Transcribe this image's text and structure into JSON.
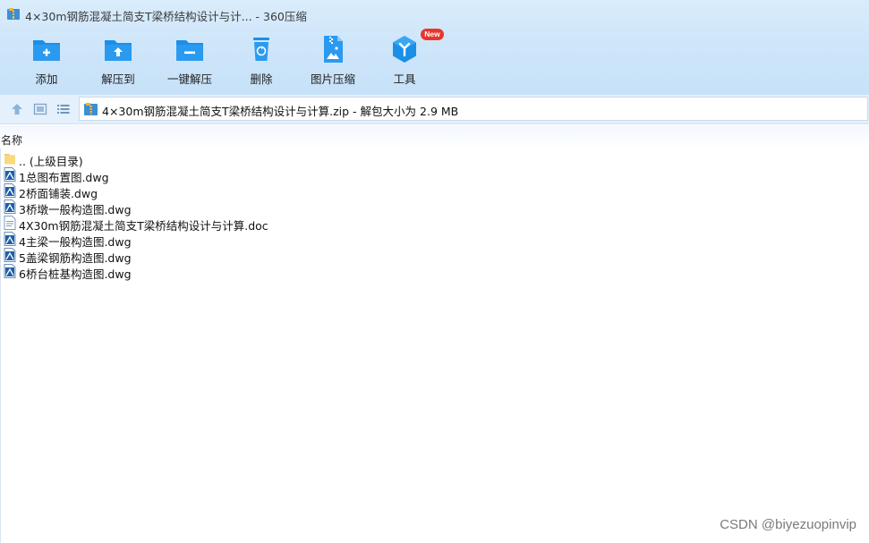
{
  "window": {
    "title": "4×30m钢筋混凝土简支T梁桥结构设计与计... - 360压缩"
  },
  "toolbar": {
    "buttons": [
      {
        "label": "添加",
        "icon": "add-folder-icon"
      },
      {
        "label": "解压到",
        "icon": "extract-folder-icon"
      },
      {
        "label": "一键解压",
        "icon": "one-click-extract-icon"
      },
      {
        "label": "删除",
        "icon": "recycle-bin-icon"
      },
      {
        "label": "图片压缩",
        "icon": "image-compress-icon"
      },
      {
        "label": "工具",
        "icon": "tools-icon",
        "badge": "New"
      }
    ]
  },
  "address_bar": {
    "path": "4×30m钢筋混凝土简支T梁桥结构设计与计算.zip - 解包大小为 2.9 MB"
  },
  "file_list": {
    "column_name": "名称",
    "items": [
      {
        "name": ".. (上级目录)",
        "type": "folder-up"
      },
      {
        "name": "1总图布置图.dwg",
        "type": "dwg"
      },
      {
        "name": "2桥面铺装.dwg",
        "type": "dwg"
      },
      {
        "name": "3桥墩一般构造图.dwg",
        "type": "dwg"
      },
      {
        "name": "4X30m钢筋混凝土简支T梁桥结构设计与计算.doc",
        "type": "doc"
      },
      {
        "name": "4主梁一般构造图.dwg",
        "type": "dwg"
      },
      {
        "name": "5盖梁钢筋构造图.dwg",
        "type": "dwg"
      },
      {
        "name": "6桥台桩基构造图.dwg",
        "type": "dwg"
      }
    ]
  },
  "watermark": "CSDN @biyezuopinvip",
  "colors": {
    "accent_blue": "#1b8fe8",
    "badge_red": "#e8362d",
    "toolbar_bg": "#cfe6fa"
  }
}
